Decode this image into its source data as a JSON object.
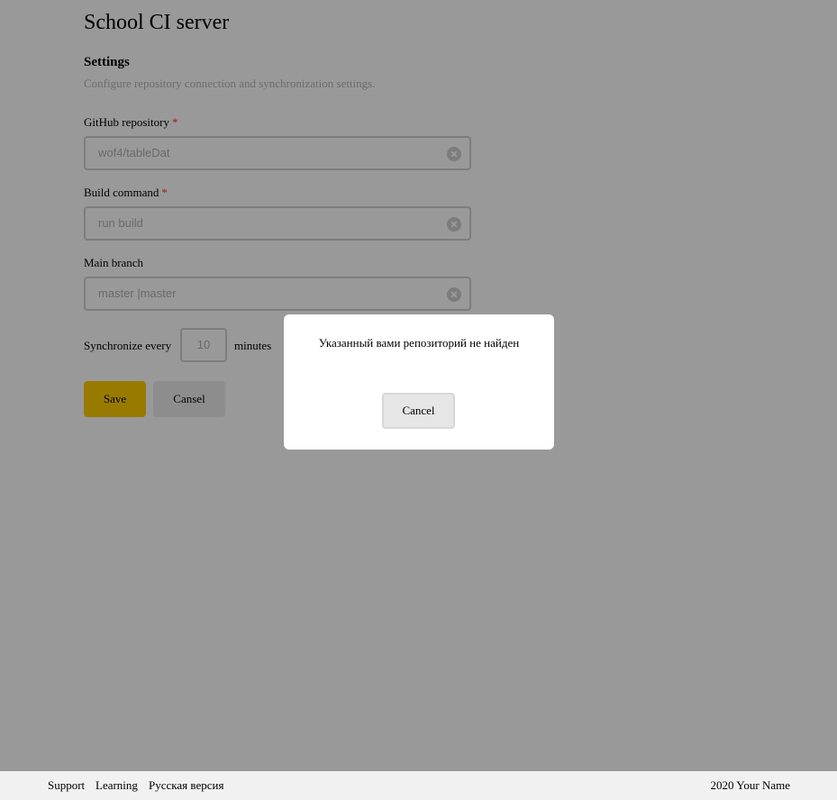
{
  "header": {
    "title": "School CI server"
  },
  "settings": {
    "title": "Settings",
    "description": "Configure repository connection and synchronization settings."
  },
  "form": {
    "repository": {
      "label": "GitHub repository",
      "required_mark": "*",
      "value": "wof4/tableDat"
    },
    "build_command": {
      "label": "Build command",
      "required_mark": "*",
      "value": "run build"
    },
    "main_branch": {
      "label": "Main branch",
      "value": "master |master"
    },
    "sync": {
      "label_before": "Synchronize every",
      "value": "10",
      "label_after": "minutes"
    },
    "save_label": "Save",
    "cancel_label": "Cansel"
  },
  "modal": {
    "message": "Указанный вами репозиторий не найден",
    "cancel_label": "Cancel"
  },
  "footer": {
    "links": [
      "Support",
      "Learning",
      "Русская версия"
    ],
    "copyright": "2020 Your Name"
  },
  "colors": {
    "accent": "#ffcc00",
    "required": "#ff3333",
    "overlay": "rgba(0,0,0,0.4)"
  },
  "icons": {
    "clear": "clear-icon"
  }
}
